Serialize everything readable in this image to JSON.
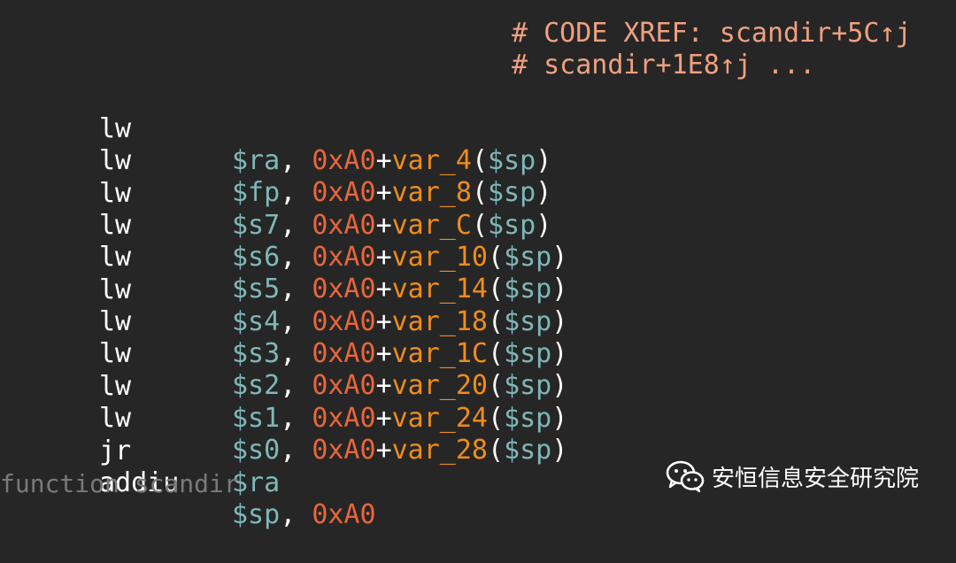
{
  "xrefs": [
    "# CODE XREF: scandir+5C↑j",
    "# scandir+1E8↑j ..."
  ],
  "instructions": [
    {
      "mnemonic": "lw",
      "reg": "$ra",
      "imm": "0xA0",
      "var": "var_4",
      "base": "$sp"
    },
    {
      "mnemonic": "lw",
      "reg": "$fp",
      "imm": "0xA0",
      "var": "var_8",
      "base": "$sp"
    },
    {
      "mnemonic": "lw",
      "reg": "$s7",
      "imm": "0xA0",
      "var": "var_C",
      "base": "$sp"
    },
    {
      "mnemonic": "lw",
      "reg": "$s6",
      "imm": "0xA0",
      "var": "var_10",
      "base": "$sp"
    },
    {
      "mnemonic": "lw",
      "reg": "$s5",
      "imm": "0xA0",
      "var": "var_14",
      "base": "$sp"
    },
    {
      "mnemonic": "lw",
      "reg": "$s4",
      "imm": "0xA0",
      "var": "var_18",
      "base": "$sp"
    },
    {
      "mnemonic": "lw",
      "reg": "$s3",
      "imm": "0xA0",
      "var": "var_1C",
      "base": "$sp"
    },
    {
      "mnemonic": "lw",
      "reg": "$s2",
      "imm": "0xA0",
      "var": "var_20",
      "base": "$sp"
    },
    {
      "mnemonic": "lw",
      "reg": "$s1",
      "imm": "0xA0",
      "var": "var_24",
      "base": "$sp"
    },
    {
      "mnemonic": "lw",
      "reg": "$s0",
      "imm": "0xA0",
      "var": "var_28",
      "base": "$sp"
    }
  ],
  "jr": {
    "mnemonic": "jr",
    "reg": "$ra"
  },
  "addiu": {
    "mnemonic": "addiu",
    "reg": "$sp",
    "imm": "0xA0"
  },
  "end_function": "function scandir",
  "watermark": {
    "icon": "wechat-icon",
    "text": "安恒信息安全研究院"
  },
  "colors": {
    "background": "#262626",
    "xref": "#f0a080",
    "mnemonic": "#ffffff",
    "register": "#7fb8b8",
    "immediate": "#e8663c",
    "variable": "#f08c1c",
    "end_function": "#7a7a7a"
  }
}
